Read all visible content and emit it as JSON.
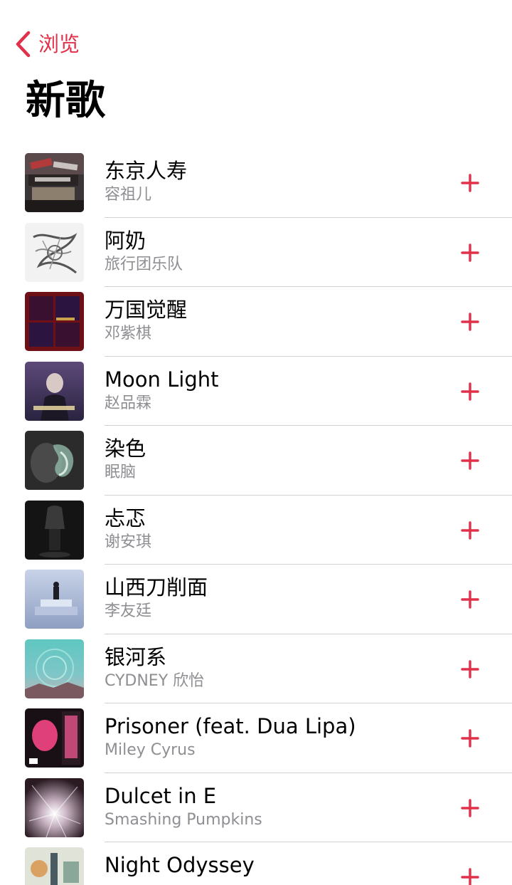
{
  "nav": {
    "back_label": "浏览",
    "back_icon": "chevron-left-icon"
  },
  "page": {
    "title": "新歌"
  },
  "colors": {
    "accent": "#e0304a",
    "secondary_text": "#8e8e93",
    "separator": "#d1d1d6"
  },
  "songs": [
    {
      "title": "东京人寿",
      "artist": "容祖儿",
      "add_icon": "plus-icon"
    },
    {
      "title": "阿奶",
      "artist": "旅行团乐队",
      "add_icon": "plus-icon"
    },
    {
      "title": "万国觉醒",
      "artist": "邓紫棋",
      "add_icon": "plus-icon"
    },
    {
      "title": "Moon Light",
      "artist": "赵品霖",
      "add_icon": "plus-icon"
    },
    {
      "title": "染色",
      "artist": "眠脑",
      "add_icon": "plus-icon"
    },
    {
      "title": "忐忑",
      "artist": "谢安琪",
      "add_icon": "plus-icon"
    },
    {
      "title": "山西刀削面",
      "artist": "李友廷",
      "add_icon": "plus-icon"
    },
    {
      "title": "银河系",
      "artist": "CYDNEY 欣怡",
      "add_icon": "plus-icon"
    },
    {
      "title": "Prisoner (feat. Dua Lipa)",
      "artist": "Miley Cyrus",
      "add_icon": "plus-icon"
    },
    {
      "title": "Dulcet in E",
      "artist": "Smashing Pumpkins",
      "add_icon": "plus-icon"
    },
    {
      "title": "Night Odyssey",
      "artist": "",
      "add_icon": "plus-icon"
    }
  ]
}
